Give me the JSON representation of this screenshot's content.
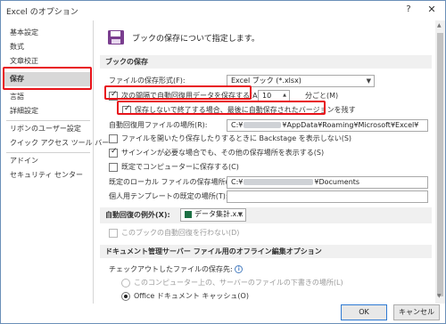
{
  "window": {
    "title": "Excel のオプション",
    "help": "?",
    "close": "✕"
  },
  "sidebar": {
    "items": [
      {
        "label": "基本設定"
      },
      {
        "label": "数式"
      },
      {
        "label": "文章校正"
      },
      {
        "label": "保存"
      },
      {
        "label": "言語"
      },
      {
        "label": "詳細設定"
      },
      {
        "label": "リボンのユーザー設定"
      },
      {
        "label": "クイック アクセス ツール バー"
      },
      {
        "label": "アドイン"
      },
      {
        "label": "セキュリティ センター"
      }
    ],
    "active": "保存"
  },
  "content": {
    "header": "ブックの保存について指定します。",
    "save_section": {
      "title": "ブックの保存",
      "format_label": "ファイルの保存形式(F):",
      "format_value": "Excel ブック (*.xlsx)",
      "autorecover_label": "次の間隔で自動回復用データを保存する(A):",
      "autorecover_checked": true,
      "interval_value": "10",
      "interval_unit": "分ごと(M)",
      "keep_last_label": "保存しないで終了する場合、最後に自動保存されたバージョンを残す",
      "keep_last_checked": true,
      "autorecover_location_label": "自動回復用ファイルの場所(R):",
      "autorecover_location_prefix": "C:¥",
      "autorecover_location_suffix": "¥AppData¥Roaming¥Microsoft¥Excel¥",
      "no_backstage_label": "ファイルを開いたり保存したりするときに Backstage を表示しない(S)",
      "no_backstage_checked": false,
      "show_locations_label": "サインインが必要な場合でも、その他の保存場所を表示する(S)",
      "show_locations_checked": true,
      "save_to_computer_label": "既定でコンピューターに保存する(C)",
      "save_to_computer_checked": false,
      "default_local_label": "既定のローカル ファイルの保存場所(I):",
      "default_local_prefix": "C:¥",
      "default_local_suffix": "¥Documents",
      "personal_template_label": "個人用テンプレートの既定の場所(T):",
      "personal_template_value": ""
    },
    "autorecover_exception": {
      "label": "自動回復の例外(X):",
      "workbook": "データ集計.x...",
      "disable_label": "このブックの自動回復を行わない(D)",
      "disable_checked": false
    },
    "offline_section": {
      "title": "ドキュメント管理サーバー ファイル用のオフライン編集オプション",
      "checkout_label": "チェックアウトしたファイルの保存先:",
      "info_icon": "info-icon",
      "option_server_label": "このコンピューター上の、サーバーのファイルの下書きの場所(L)",
      "option_cache_label": "Office ドキュメント キャッシュ(O)",
      "selected": "cache"
    }
  },
  "footer": {
    "ok": "OK",
    "cancel": "キャンセル"
  },
  "colors": {
    "highlight": "#e8131a",
    "accent": "#2f7ad3",
    "excel_green": "#1e7145"
  }
}
